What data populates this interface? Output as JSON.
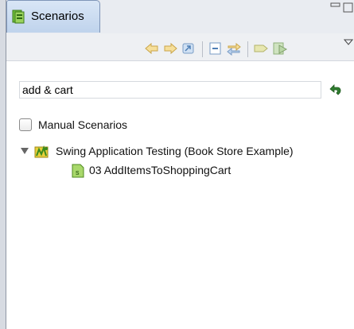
{
  "view": {
    "tab_title": "Scenarios",
    "tab_icon": "scenarios-view-icon"
  },
  "toolbar": {
    "buttons": [
      "back-arrow-icon",
      "forward-arrow-icon",
      "home-icon",
      "collapse-all-icon",
      "link-with-editor-icon",
      "tag-icon",
      "run-scenario-icon",
      "view-menu-icon"
    ]
  },
  "search": {
    "value": "add & cart",
    "clear_icon": "undo-icon"
  },
  "filter": {
    "manual_scenarios_label": "Manual Scenarios",
    "manual_scenarios_checked": false
  },
  "tree": {
    "root": {
      "label": "Swing Application Testing (Book Store Example)",
      "expanded": true
    },
    "children": [
      {
        "label": "03 AddItemsToShoppingCart"
      }
    ]
  }
}
